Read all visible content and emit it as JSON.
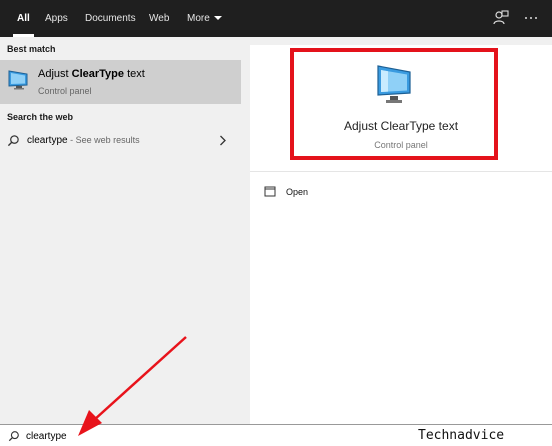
{
  "topbar": {
    "tabs": [
      {
        "label": "All"
      },
      {
        "label": "Apps"
      },
      {
        "label": "Documents"
      },
      {
        "label": "Web"
      },
      {
        "label": "More"
      }
    ],
    "icons": [
      "feedback-icon",
      "ellipsis-icon"
    ]
  },
  "left": {
    "best_match_heading": "Best match",
    "best_match": {
      "title_prefix": "Adjust ",
      "title_bold": "ClearType",
      "title_suffix": " text",
      "subtitle": "Control panel",
      "icon": "monitor-icon"
    },
    "search_web_heading": "Search the web",
    "web_result": {
      "query": "cleartype",
      "hint": " - See web results",
      "icon": "search-icon"
    }
  },
  "preview": {
    "title": "Adjust ClearType text",
    "subtitle": "Control panel",
    "highlight_color": "#e4121b",
    "actions": [
      {
        "label": "Open",
        "icon": "open-window-icon"
      }
    ]
  },
  "search": {
    "value": "cleartype",
    "icon": "search-icon"
  },
  "watermark": "Technadvice",
  "annotation": {
    "arrow_color": "#e8131b"
  }
}
